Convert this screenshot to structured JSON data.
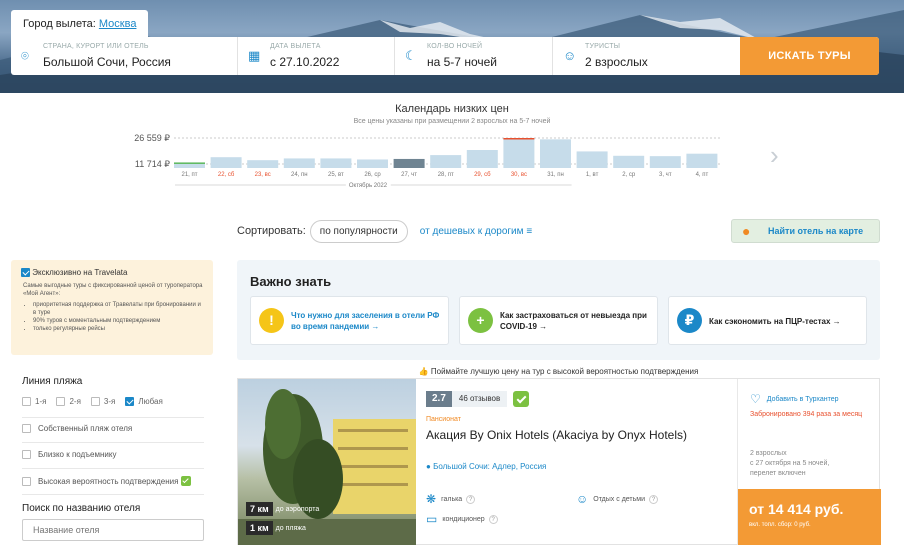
{
  "header": {
    "departure_label": "Город вылета:",
    "departure_city": "Москва",
    "fields": {
      "destination": {
        "label": "СТРАНА, КУРОРТ ИЛИ ОТЕЛЬ",
        "value": "Большой Сочи, Россия"
      },
      "date": {
        "label": "ДАТА ВЫЛЕТА",
        "value": "с 27.10.2022"
      },
      "nights": {
        "label": "КОЛ-ВО НОЧЕЙ",
        "value": "на 5-7 ночей"
      },
      "tourists": {
        "label": "ТУРИСТЫ",
        "value": "2 взрослых"
      }
    },
    "search_button": "ИСКАТЬ ТУРЫ"
  },
  "calendar": {
    "title": "Календарь низких цен",
    "subtitle": "Все цены указаны при размещении 2 взрослых на 5-7 ночей",
    "month_label": "Октябрь 2022"
  },
  "chart_data": {
    "type": "bar",
    "y_labels": [
      "26 559 ₽",
      "11 714 ₽"
    ],
    "ylim": [
      11714,
      26559
    ],
    "categories": [
      "21, пт",
      "22, сб",
      "23, вс",
      "24, пн",
      "25, вт",
      "26, ср",
      "27, чт",
      "28, пт",
      "29, сб",
      "30, вс",
      "31, пн",
      "1, вт",
      "2, ср",
      "3, чт",
      "4, пт"
    ],
    "weekend": [
      false,
      true,
      true,
      false,
      false,
      false,
      false,
      false,
      true,
      true,
      false,
      false,
      false,
      false,
      false
    ],
    "selected_index": 6,
    "max_index": 9,
    "values": [
      12600,
      15600,
      13900,
      14900,
      14900,
      14300,
      14600,
      16800,
      19700,
      26559,
      25800,
      18900,
      16400,
      16200,
      17600
    ]
  },
  "sort": {
    "label": "Сортировать:",
    "popular": "по популярности",
    "cheap": "от дешевых к дорогим"
  },
  "map_button": "Найти отель на карте",
  "exclusive": {
    "title": "Эксклюзивно на Travelata",
    "desc": "Самые выгодные туры с фиксированной ценой от туроператора «Мой Агент»:",
    "items": [
      "приоритетная поддержка от Травелаты при бронировании и в туре",
      "90% туров с моментальным подтверждением",
      "только регулярные рейсы"
    ]
  },
  "beach": {
    "title": "Линия пляжа",
    "options": [
      "1-я",
      "2-я",
      "3-я",
      "Любая"
    ]
  },
  "filters": [
    "Собственный пляж отеля",
    "Близко к подъемнику",
    "Высокая вероятность подтверждения"
  ],
  "hotel_search": {
    "title": "Поиск по названию отеля",
    "placeholder": "Название отеля"
  },
  "important": {
    "title": "Важно знать",
    "cards": [
      {
        "icon": "!",
        "color": "#f5c518",
        "text": "Что нужно для заселения в отели РФ во время пандемии →"
      },
      {
        "icon": "+",
        "color": "#7cc141",
        "text": "Как застраховаться от невыезда при COVID-19 →"
      },
      {
        "icon": "₽",
        "color": "#1b88c8",
        "text": "Как сэкономить на ПЦР-тестах →"
      }
    ]
  },
  "promo": "Поймайте лучшую цену на тур с высокой вероятностью подтверждения",
  "hotel": {
    "rating": "2.7",
    "reviews": "46 отзывов",
    "type": "Пансионат",
    "name": "Акация By Onix Hotels (Akaciya by Onyx Hotels)",
    "location": "Большой Сочи: Адлер, Россия",
    "dist_airport_val": "7 км",
    "dist_airport_txt": "до аэропорта",
    "dist_beach_val": "1 км",
    "dist_beach_txt": "до пляжа",
    "amenities": [
      "галька",
      "Отдых с детьми",
      "кондиционер"
    ],
    "fav": "Добавить в Турхантер",
    "booked": "Забронировано 394 раза за месяц",
    "details": "2 взрослых\nс 27 октября на 5 ночей,\nперелет включен",
    "price": "от 14 414 руб.",
    "fee": "вкл. топл. сбор: 0 руб."
  }
}
